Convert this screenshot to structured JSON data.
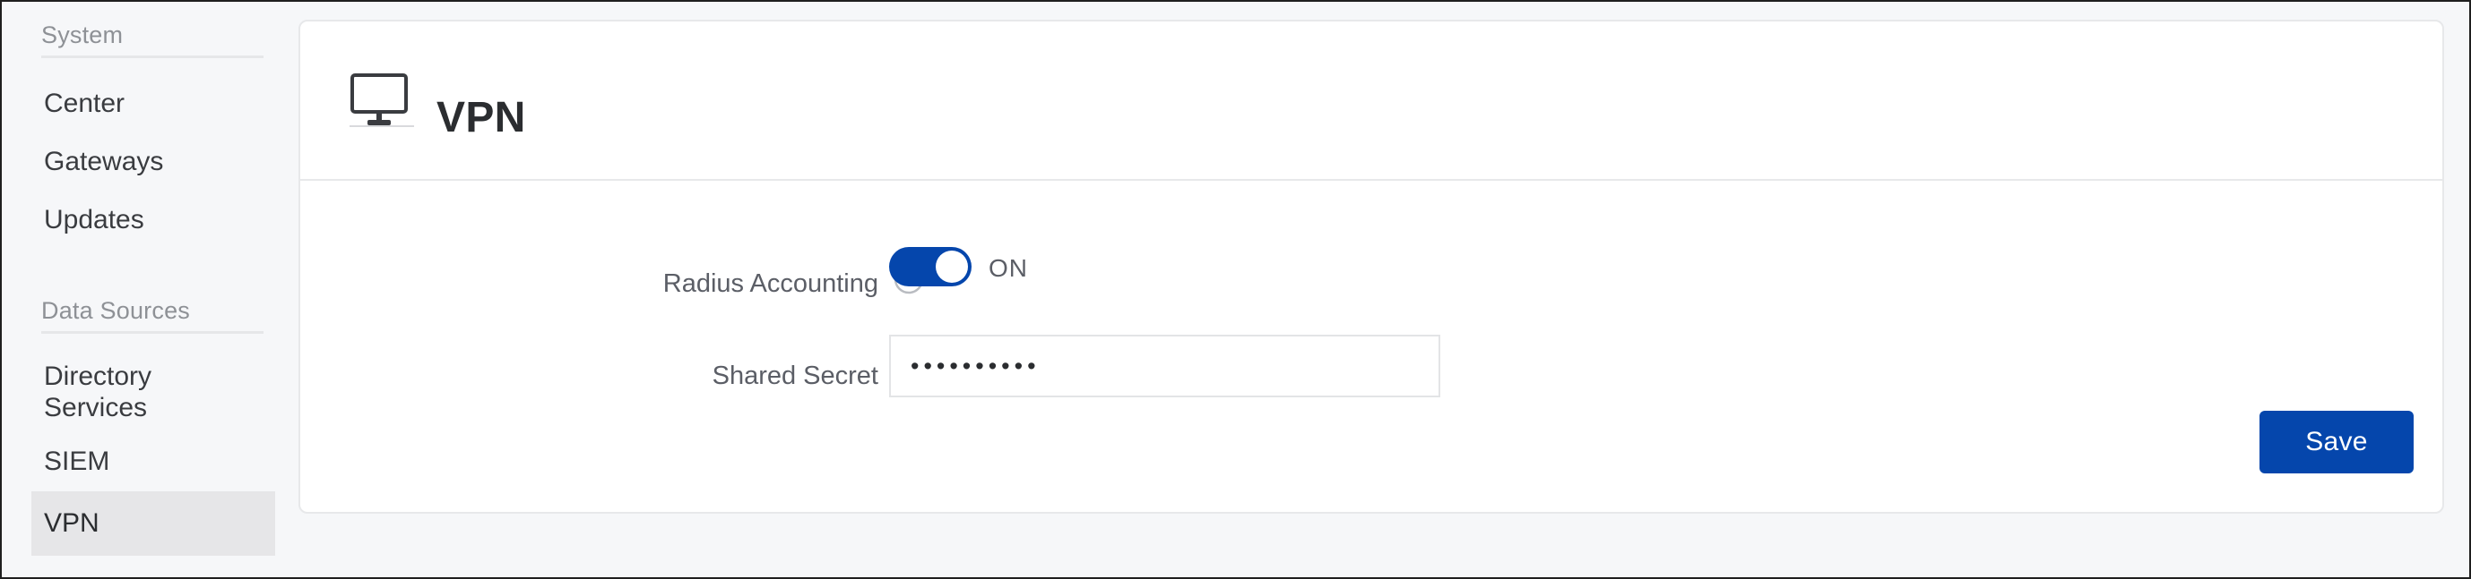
{
  "sidebar": {
    "sections": [
      {
        "title": "System",
        "items": [
          {
            "label": "Center",
            "selected": false
          },
          {
            "label": "Gateways",
            "selected": false
          },
          {
            "label": "Updates",
            "selected": false
          }
        ]
      },
      {
        "title": "Data Sources",
        "items": [
          {
            "label": "Directory Services",
            "selected": false
          },
          {
            "label": "SIEM",
            "selected": false
          },
          {
            "label": "VPN",
            "selected": true
          }
        ]
      }
    ],
    "item_labels": {
      "center": "Center",
      "gateways": "Gateways",
      "updates": "Updates",
      "directory_services_line1": "Directory",
      "directory_services_line2": "Services",
      "siem": "SIEM",
      "vpn": "VPN"
    },
    "section_titles": {
      "system": "System",
      "data_sources": "Data Sources"
    }
  },
  "card": {
    "title": "VPN",
    "icon": "monitor-icon"
  },
  "form": {
    "radius_accounting": {
      "label": "Radius Accounting",
      "help_icon": "help-circle-icon",
      "toggle_state": "ON",
      "toggle_on": true
    },
    "shared_secret": {
      "label": "Shared Secret",
      "value": "••••••••••",
      "placeholder": ""
    }
  },
  "actions": {
    "save_label": "Save"
  },
  "colors": {
    "accent_blue": "#0546ac",
    "page_background": "#f6f7f9",
    "card_background": "#ffffff",
    "selected_item": "#e6e6e8",
    "border": "#e7e8ea",
    "label_text": "#5b5e66",
    "muted_text": "#8e9196"
  }
}
